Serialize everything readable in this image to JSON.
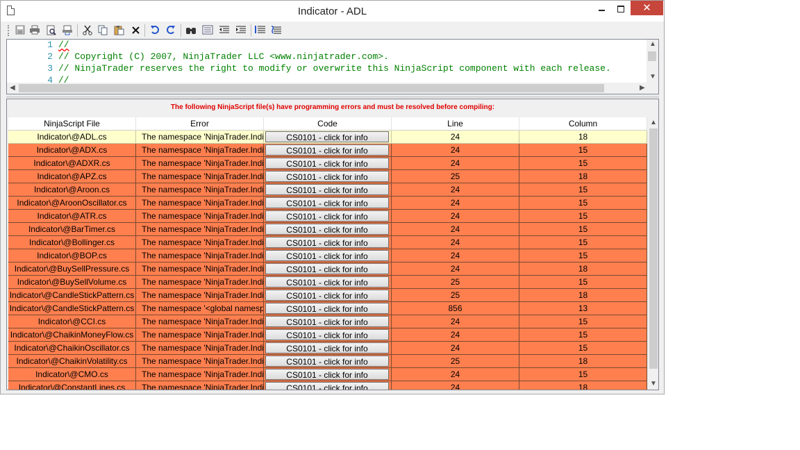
{
  "window": {
    "title": "Indicator - ADL",
    "close_glyph": "✕"
  },
  "icons": {
    "save": "save-icon",
    "print": "print-icon",
    "print_preview": "print-preview-icon",
    "page_setup": "page-setup-icon",
    "cut": "cut-icon",
    "copy": "copy-icon",
    "paste": "paste-icon",
    "delete": "delete-icon",
    "undo": "undo-icon",
    "redo": "redo-icon",
    "find": "find-icon",
    "replace": "replace-icon",
    "outdent": "outdent-icon",
    "indent": "indent-icon",
    "comment": "comment-icon",
    "uncomment": "uncomment-icon"
  },
  "editor": {
    "lines": [
      {
        "num": "1",
        "text": "//"
      },
      {
        "num": "2",
        "text": "// Copyright (C) 2007, NinjaTrader LLC <www.ninjatrader.com>."
      },
      {
        "num": "3",
        "text": "// NinjaTrader reserves the right to modify or overwrite this NinjaScript component with each release."
      },
      {
        "num": "4",
        "text": "//"
      }
    ]
  },
  "errors": {
    "header": "The following NinjaScript file(s) have programming errors and must be resolved before compiling:",
    "columns": [
      "NinjaScript File",
      "Error",
      "Code",
      "Line",
      "Column"
    ],
    "rows": [
      {
        "file": "Indicator\\@ADL.cs",
        "error": "The namespace 'NinjaTrader.Indic",
        "code": "CS0101 - click for info",
        "line": "24",
        "column": "18"
      },
      {
        "file": "Indicator\\@ADX.cs",
        "error": "The namespace 'NinjaTrader.Indic",
        "code": "CS0101 - click for info",
        "line": "24",
        "column": "15"
      },
      {
        "file": "Indicator\\@ADXR.cs",
        "error": "The namespace 'NinjaTrader.Indic",
        "code": "CS0101 - click for info",
        "line": "24",
        "column": "15"
      },
      {
        "file": "Indicator\\@APZ.cs",
        "error": "The namespace 'NinjaTrader.Indic",
        "code": "CS0101 - click for info",
        "line": "25",
        "column": "18"
      },
      {
        "file": "Indicator\\@Aroon.cs",
        "error": "The namespace 'NinjaTrader.Indic",
        "code": "CS0101 - click for info",
        "line": "24",
        "column": "15"
      },
      {
        "file": "Indicator\\@AroonOscillator.cs",
        "error": "The namespace 'NinjaTrader.Indic",
        "code": "CS0101 - click for info",
        "line": "24",
        "column": "15"
      },
      {
        "file": "Indicator\\@ATR.cs",
        "error": "The namespace 'NinjaTrader.Indic",
        "code": "CS0101 - click for info",
        "line": "24",
        "column": "15"
      },
      {
        "file": "Indicator\\@BarTimer.cs",
        "error": "The namespace 'NinjaTrader.Indic",
        "code": "CS0101 - click for info",
        "line": "24",
        "column": "15"
      },
      {
        "file": "Indicator\\@Bollinger.cs",
        "error": "The namespace 'NinjaTrader.Indic",
        "code": "CS0101 - click for info",
        "line": "24",
        "column": "15"
      },
      {
        "file": "Indicator\\@BOP.cs",
        "error": "The namespace 'NinjaTrader.Indic",
        "code": "CS0101 - click for info",
        "line": "24",
        "column": "15"
      },
      {
        "file": "Indicator\\@BuySellPressure.cs",
        "error": "The namespace 'NinjaTrader.Indic",
        "code": "CS0101 - click for info",
        "line": "24",
        "column": "18"
      },
      {
        "file": "Indicator\\@BuySellVolume.cs",
        "error": "The namespace 'NinjaTrader.Indic",
        "code": "CS0101 - click for info",
        "line": "25",
        "column": "15"
      },
      {
        "file": "Indicator\\@CandleStickPattern.cs",
        "error": "The namespace 'NinjaTrader.Indic",
        "code": "CS0101 - click for info",
        "line": "25",
        "column": "18"
      },
      {
        "file": "Indicator\\@CandleStickPattern.cs",
        "error": "The namespace '<global namespa",
        "code": "CS0101 - click for info",
        "line": "856",
        "column": "13"
      },
      {
        "file": "Indicator\\@CCI.cs",
        "error": "The namespace 'NinjaTrader.Indic",
        "code": "CS0101 - click for info",
        "line": "24",
        "column": "15"
      },
      {
        "file": "Indicator\\@ChaikinMoneyFlow.cs",
        "error": "The namespace 'NinjaTrader.Indic",
        "code": "CS0101 - click for info",
        "line": "24",
        "column": "15"
      },
      {
        "file": "Indicator\\@ChaikinOscillator.cs",
        "error": "The namespace 'NinjaTrader.Indic",
        "code": "CS0101 - click for info",
        "line": "24",
        "column": "15"
      },
      {
        "file": "Indicator\\@ChaikinVolatility.cs",
        "error": "The namespace 'NinjaTrader.Indic",
        "code": "CS0101 - click for info",
        "line": "25",
        "column": "18"
      },
      {
        "file": "Indicator\\@CMO.cs",
        "error": "The namespace 'NinjaTrader.Indic",
        "code": "CS0101 - click for info",
        "line": "24",
        "column": "15"
      },
      {
        "file": "Indicator\\@ConstantLines.cs",
        "error": "The namespace 'NinjaTrader.Indic",
        "code": "CS0101 - click for info",
        "line": "24",
        "column": "18"
      }
    ]
  }
}
